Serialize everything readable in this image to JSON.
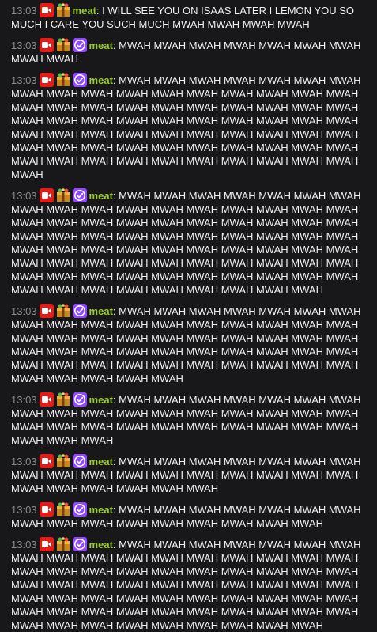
{
  "chat": {
    "messages": [
      {
        "time": "13:03",
        "user": "meat",
        "sep": ":",
        "text": "I WILL SEE YOU ON ISAAS LATER I LEMON YOU SO MUCH I CARE YOU SUCH MUCH MWAH MWAH MWAH MWAH",
        "badges": [
          "broadcaster-badge",
          "gift-badge"
        ]
      },
      {
        "time": "13:03",
        "user": "meat",
        "sep": ":",
        "text": "MWAH MWAH MWAH MWAH MWAH MWAH MWAH MWAH MWAH",
        "badges": [
          "broadcaster-badge",
          "gift-badge",
          "verified-badge"
        ]
      },
      {
        "time": "13:03",
        "user": "meat",
        "sep": ":",
        "text": "MWAH MWAH MWAH MWAH MWAH MWAH MWAH MWAH MWAH MWAH MWAH MWAH MWAH MWAH MWAH MWAH MWAH MWAH MWAH MWAH MWAH MWAH MWAH MWAH MWAH MWAH MWAH MWAH MWAH MWAH MWAH MWAH MWAH MWAH MWAH MWAH MWAH MWAH MWAH MWAH MWAH MWAH MWAH MWAH MWAH MWAH MWAH MWAH MWAH MWAH MWAH MWAH MWAH MWAH MWAH MWAH MWAH MWAH MWAH MWAH MWAH MWAH MWAH MWAH MWAH MWAH MWAH MWAH",
        "badges": [
          "broadcaster-badge",
          "gift-badge",
          "verified-badge"
        ]
      },
      {
        "time": "13:03",
        "user": "meat",
        "sep": ":",
        "text": "MWAH MWAH MWAH MWAH MWAH MWAH MWAH MWAH MWAH MWAH MWAH MWAH MWAH MWAH MWAH MWAH MWAH MWAH MWAH MWAH MWAH MWAH MWAH MWAH MWAH MWAH MWAH MWAH MWAH MWAH MWAH MWAH MWAH MWAH MWAH MWAH MWAH MWAH MWAH MWAH MWAH MWAH MWAH MWAH MWAH MWAH MWAH MWAH MWAH MWAH MWAH MWAH MWAH MWAH MWAH MWAH MWAH MWAH MWAH MWAH MWAH MWAH MWAH MWAH MWAH MWAH MWAH MWAH MWAH MWAH MWAH MWAH MWAH MWAH MWAH MWAH",
        "badges": [
          "broadcaster-badge",
          "gift-badge",
          "verified-badge"
        ]
      },
      {
        "time": "13:03",
        "user": "meat",
        "sep": ":",
        "text": "MWAH MWAH MWAH MWAH MWAH MWAH MWAH MWAH MWAH MWAH MWAH MWAH MWAH MWAH MWAH MWAH MWAH MWAH MWAH MWAH MWAH MWAH MWAH MWAH MWAH MWAH MWAH MWAH MWAH MWAH MWAH MWAH MWAH MWAH MWAH MWAH MWAH MWAH MWAH MWAH MWAH MWAH MWAH MWAH MWAH MWAH MWAH MWAH MWAH MWAH MWAH MWAH",
        "badges": [
          "broadcaster-badge",
          "gift-badge",
          "verified-badge"
        ]
      },
      {
        "time": "13:03",
        "user": "meat",
        "sep": ":",
        "text": "MWAH MWAH MWAH MWAH MWAH MWAH MWAH MWAH MWAH MWAH MWAH MWAH MWAH MWAH MWAH MWAH MWAH MWAH MWAH MWAH MWAH MWAH MWAH MWAH MWAH MWAH MWAH MWAH MWAH MWAH",
        "badges": [
          "broadcaster-badge",
          "gift-badge",
          "verified-badge"
        ]
      },
      {
        "time": "13:03",
        "user": "meat",
        "sep": ":",
        "text": "MWAH MWAH MWAH MWAH MWAH MWAH MWAH MWAH MWAH MWAH MWAH MWAH MWAH MWAH MWAH MWAH MWAH MWAH MWAH MWAH MWAH MWAH MWAH",
        "badges": [
          "broadcaster-badge",
          "gift-badge",
          "verified-badge"
        ]
      },
      {
        "time": "13:03",
        "user": "meat",
        "sep": ":",
        "text": "MWAH MWAH MWAH MWAH MWAH MWAH MWAH MWAH MWAH MWAH MWAH MWAH MWAH MWAH MWAH MWAH",
        "badges": [
          "broadcaster-badge",
          "gift-badge",
          "verified-badge"
        ]
      },
      {
        "time": "13:03",
        "user": "meat",
        "sep": ":",
        "text": "MWAH MWAH MWAH MWAH MWAH MWAH MWAH MWAH MWAH MWAH MWAH MWAH MWAH MWAH MWAH MWAH MWAH MWAH MWAH MWAH MWAH MWAH MWAH MWAH MWAH MWAH MWAH MWAH MWAH MWAH MWAH MWAH MWAH MWAH MWAH MWAH MWAH MWAH MWAH MWAH MWAH MWAH MWAH MWAH MWAH MWAH MWAH MWAH MWAH MWAH MWAH MWAH MWAH MWAH MWAH MWAH MWAH MWAH MWAH MWAH MWAH MWAH MWAH MWAH MWAH MWAH",
        "badges": [
          "broadcaster-badge",
          "gift-badge",
          "verified-badge"
        ]
      }
    ]
  },
  "colors": {
    "background": "#18181b",
    "timestamp": "#8a8a8e",
    "username": "#9acd32",
    "text": "#efeff1",
    "broadcaster_badge": "#e91916",
    "verified_badge": "#9147ff"
  }
}
